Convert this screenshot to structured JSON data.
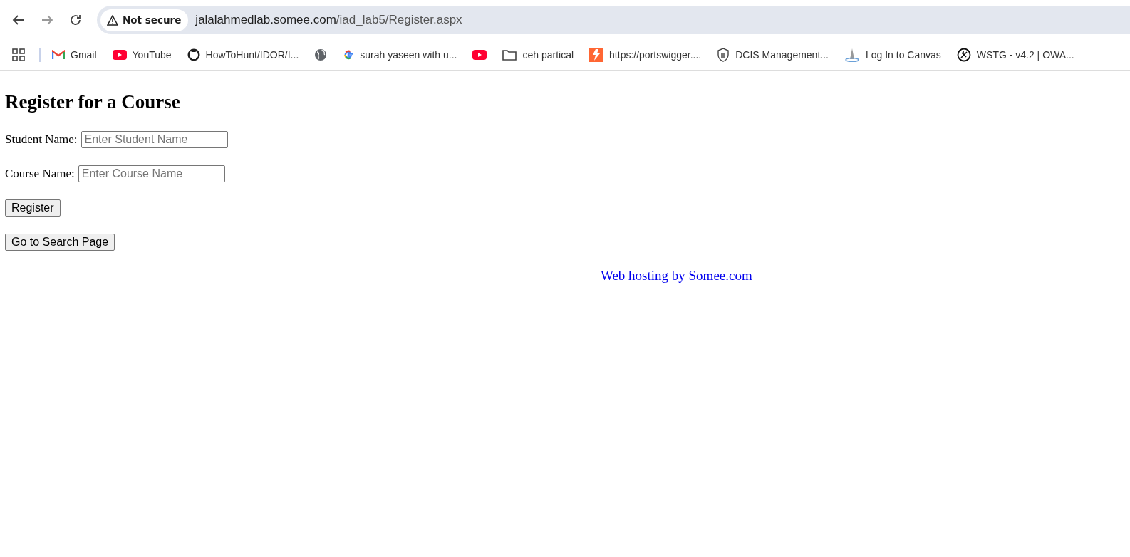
{
  "browser": {
    "nav": [
      {
        "kind": "back",
        "disabled": false
      },
      {
        "kind": "forward",
        "disabled": true
      },
      {
        "kind": "reload",
        "disabled": false
      }
    ],
    "security_badge": "Not secure",
    "address": {
      "host": "jalalahmedlab.somee.com",
      "path": "/iad_lab5/Register.aspx"
    },
    "bookmarks": [
      {
        "kind": "apps"
      },
      {
        "kind": "gmail",
        "label": "Gmail"
      },
      {
        "kind": "youtube",
        "label": "YouTube"
      },
      {
        "kind": "github",
        "label": "HowToHunt/IDOR/I..."
      },
      {
        "kind": "globe"
      },
      {
        "kind": "google",
        "label": "surah yaseen with u..."
      },
      {
        "kind": "youtube"
      },
      {
        "kind": "folder",
        "label": "ceh partical"
      },
      {
        "kind": "portswigger",
        "label": "https://portswigger...."
      },
      {
        "kind": "shield",
        "label": "DCIS Management..."
      },
      {
        "kind": "canvas",
        "label": "Log In to Canvas"
      },
      {
        "kind": "owasp",
        "label": "WSTG - v4.2 | OWA..."
      }
    ]
  },
  "page": {
    "heading": "Register for a Course",
    "fields": [
      {
        "label": "Student Name:",
        "placeholder": "Enter Student Name"
      },
      {
        "label": "Course Name:",
        "placeholder": "Enter Course Name"
      }
    ],
    "buttons": [
      "Register",
      "Go to Search Page"
    ],
    "footer_link": "Web hosting by Somee.com"
  }
}
